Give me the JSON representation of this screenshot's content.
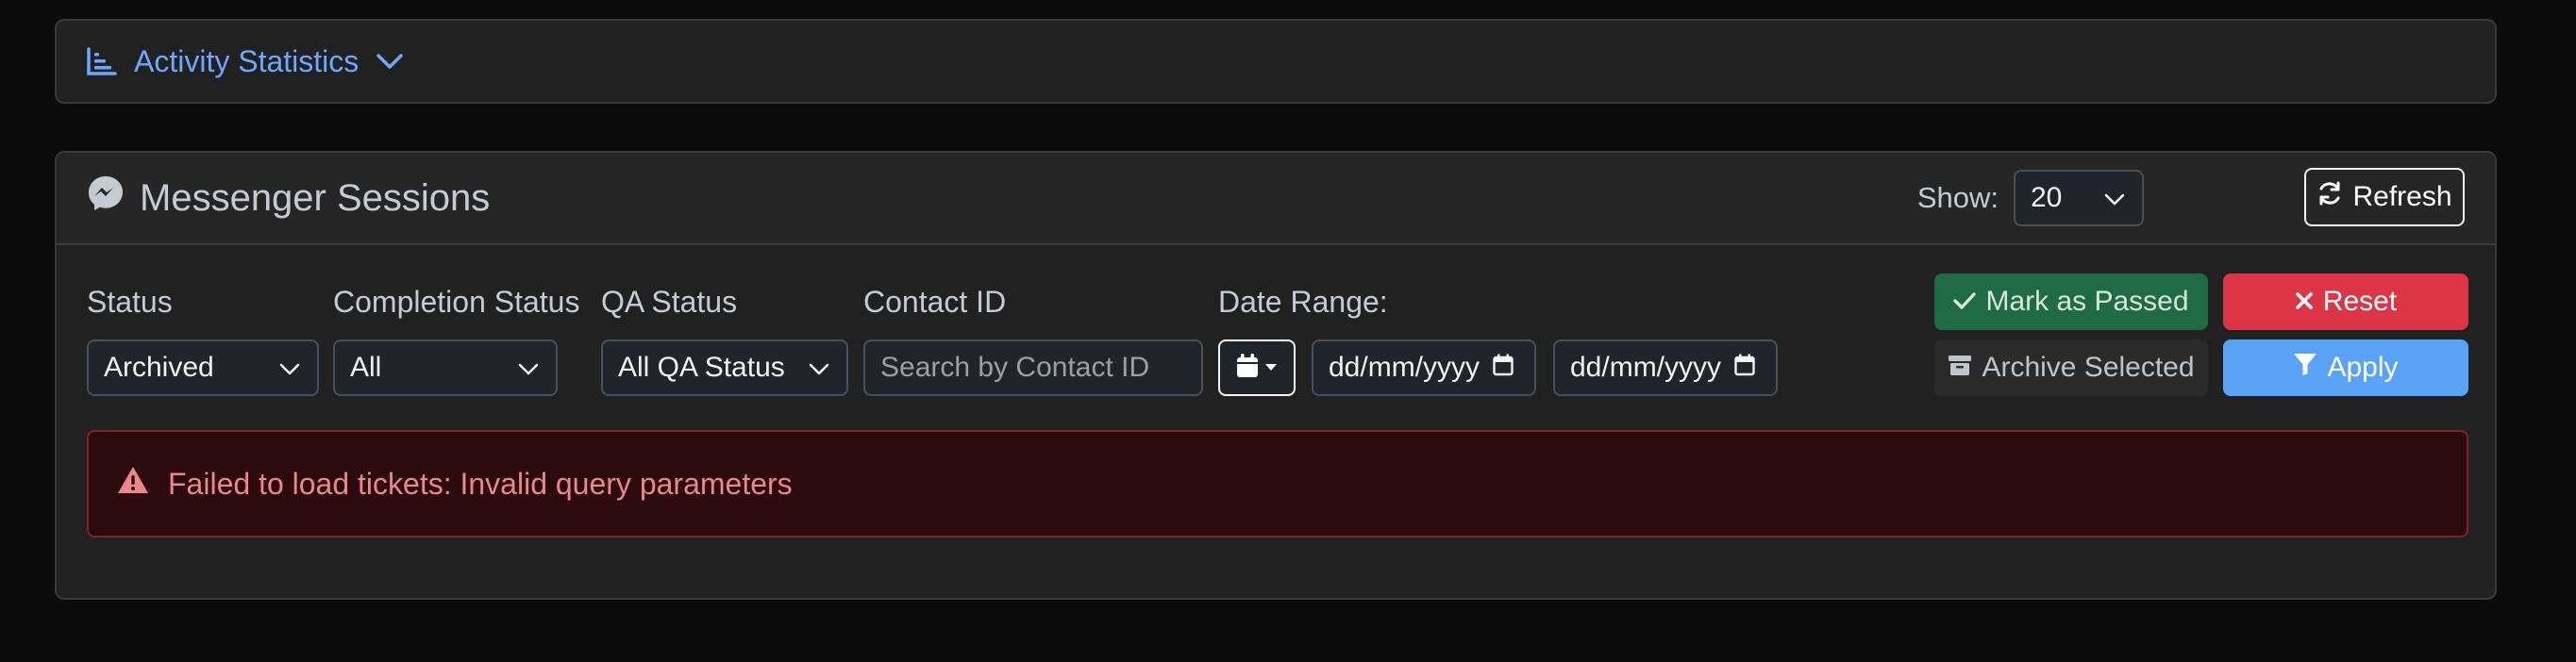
{
  "stats": {
    "title": "Activity Statistics"
  },
  "sessions": {
    "title": "Messenger Sessions",
    "show_label": "Show:",
    "show_value": "20",
    "refresh_label": "Refresh"
  },
  "filters": {
    "status": {
      "label": "Status",
      "value": "Archived"
    },
    "completion": {
      "label": "Completion Status",
      "value": "All"
    },
    "qa": {
      "label": "QA Status",
      "value": "All QA Status"
    },
    "contact": {
      "label": "Contact ID",
      "placeholder": "Search by Contact ID"
    },
    "date": {
      "label": "Date Range:",
      "from": "dd/mm/yyyy",
      "to": "dd/mm/yyyy"
    }
  },
  "actions": {
    "mark_passed": "Mark as Passed",
    "reset": "Reset",
    "archive": "Archive Selected",
    "apply": "Apply"
  },
  "alert": {
    "message": "Failed to load tickets: Invalid query parameters"
  },
  "colors": {
    "accent_blue": "#6ea8fe",
    "success": "#1f6b46",
    "danger": "#dc3545",
    "primary": "#5aa2f5",
    "alert_bg": "#2c0b0e"
  },
  "icons": [
    "chart-bar-icon",
    "chevron-down-icon",
    "messenger-icon",
    "refresh-icon",
    "calendar-icon",
    "check-icon",
    "x-icon",
    "archive-icon",
    "filter-icon",
    "warning-icon"
  ]
}
